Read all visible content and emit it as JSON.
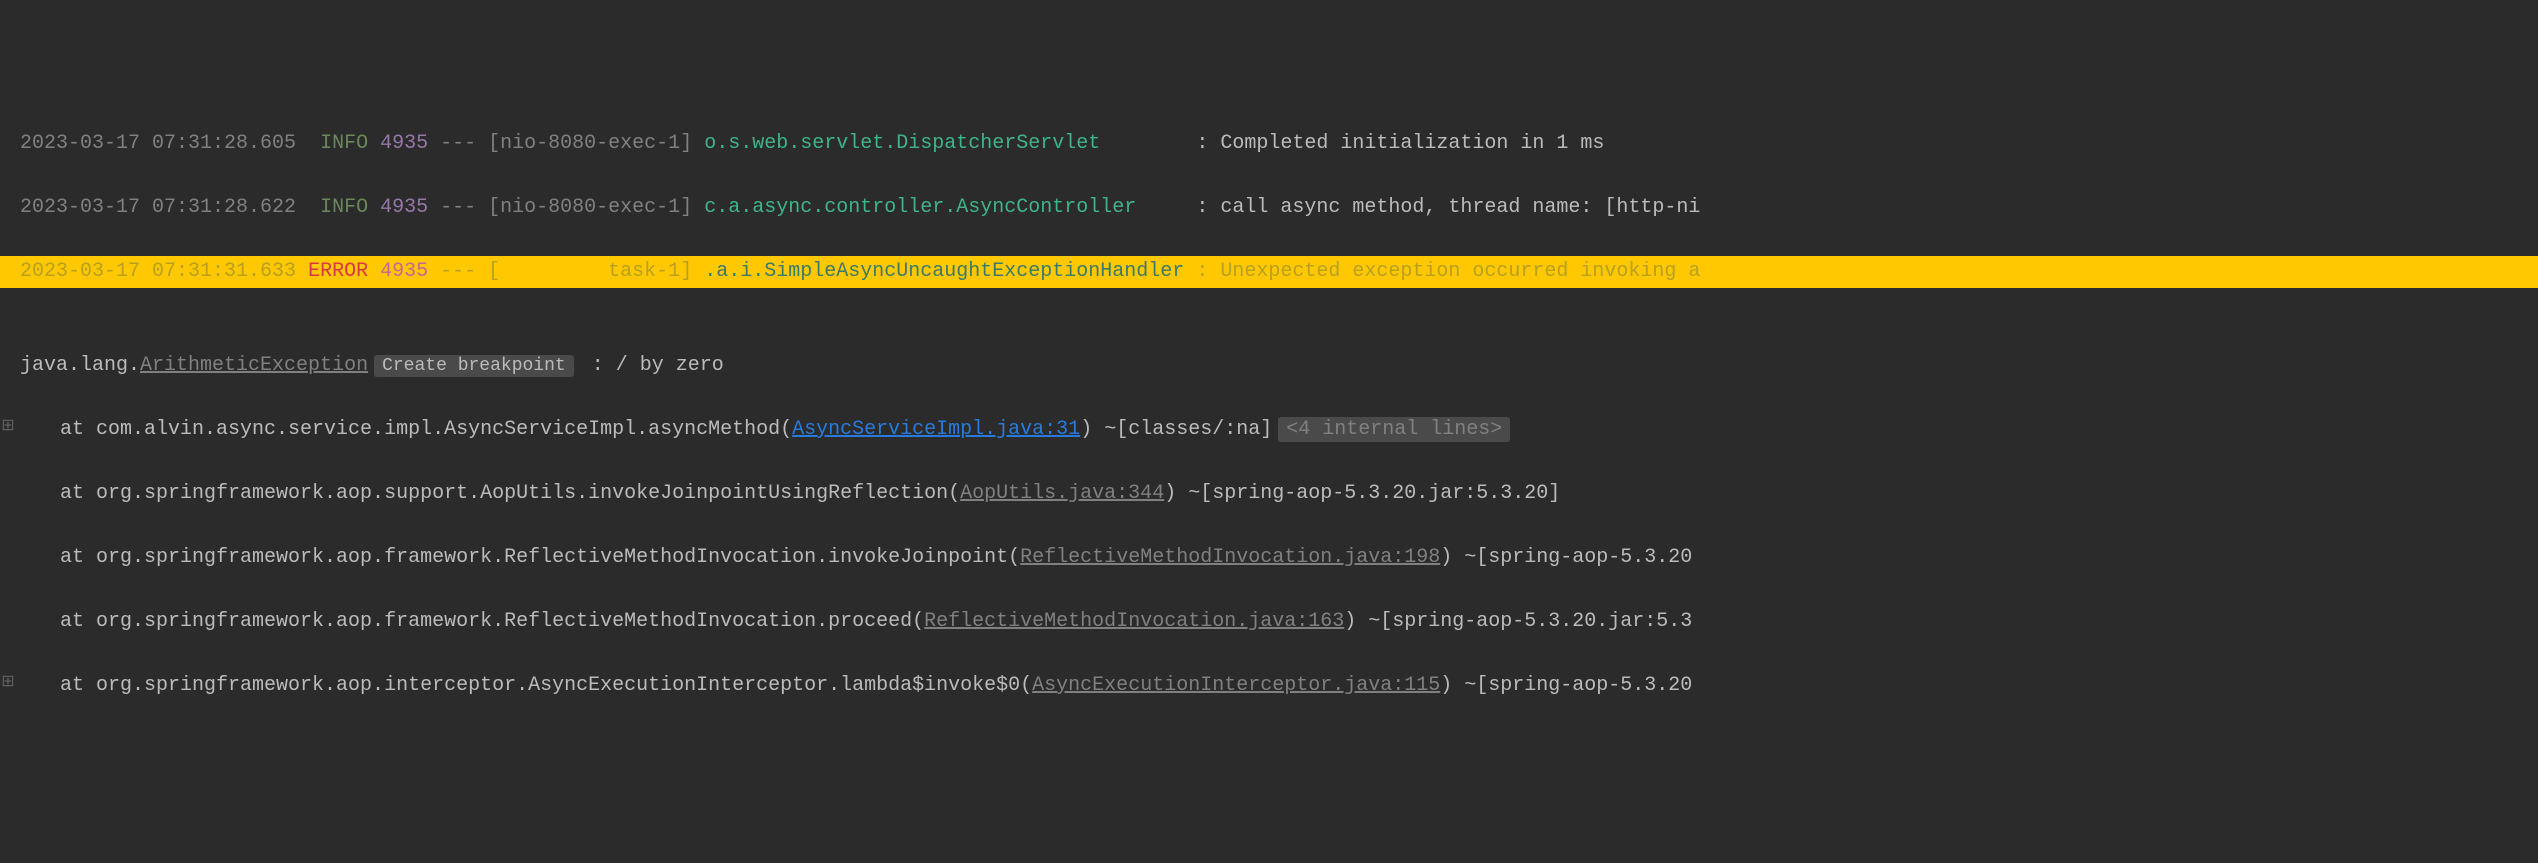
{
  "log_lines": [
    {
      "timestamp": "2023-03-17 07:31:28.605",
      "level": "INFO",
      "pid": "4935",
      "separator": "---",
      "thread": "[nio-8080-exec-1]",
      "logger": "o.s.web.servlet.DispatcherServlet",
      "message": ": Completed initialization in 1 ms"
    },
    {
      "timestamp": "2023-03-17 07:31:28.622",
      "level": "INFO",
      "pid": "4935",
      "separator": "---",
      "thread": "[nio-8080-exec-1]",
      "logger": "c.a.async.controller.AsyncController",
      "message": ": call async method, thread name: [http-ni"
    }
  ],
  "error_line": {
    "timestamp": "2023-03-17 07:31:31.633",
    "level": "ERROR",
    "pid": "4935",
    "separator": "---",
    "thread": "[         task-1]",
    "logger": ".a.i.SimpleAsyncUncaughtExceptionHandler",
    "message": ": Unexpected exception occurred invoking a"
  },
  "exception": {
    "prefix": "java.lang.",
    "type": "ArithmeticException",
    "breakpoint_label": "Create breakpoint",
    "message": " : / by zero"
  },
  "stack": [
    {
      "at": "at ",
      "method": "com.alvin.async.service.impl.AsyncServiceImpl.asyncMethod(",
      "file": "AsyncServiceImpl.java:31",
      "file_link_style": "blue",
      "suffix": ") ~[classes/:na]",
      "internal": "<4 internal lines>",
      "has_gutter": true
    },
    {
      "at": "at ",
      "method": "org.springframework.aop.support.AopUtils.invokeJoinpointUsingReflection(",
      "file": "AopUtils.java:344",
      "file_link_style": "gray",
      "suffix": ") ~[spring-aop-5.3.20.jar:5.3.20]",
      "has_gutter": false
    },
    {
      "at": "at ",
      "method": "org.springframework.aop.framework.ReflectiveMethodInvocation.invokeJoinpoint(",
      "file": "ReflectiveMethodInvocation.java:198",
      "file_link_style": "gray",
      "suffix": ") ~[spring-aop-5.3.20",
      "has_gutter": false
    },
    {
      "at": "at ",
      "method": "org.springframework.aop.framework.ReflectiveMethodInvocation.proceed(",
      "file": "ReflectiveMethodInvocation.java:163",
      "file_link_style": "gray",
      "suffix": ") ~[spring-aop-5.3.20.jar:5.3",
      "has_gutter": false
    },
    {
      "at": "at ",
      "method": "org.springframework.aop.interceptor.AsyncExecutionInterceptor.lambda$invoke$0(",
      "file": "AsyncExecutionInterceptor.java:115",
      "file_link_style": "gray",
      "suffix": ") ~[spring-aop-5.3.20",
      "has_gutter": true
    }
  ]
}
